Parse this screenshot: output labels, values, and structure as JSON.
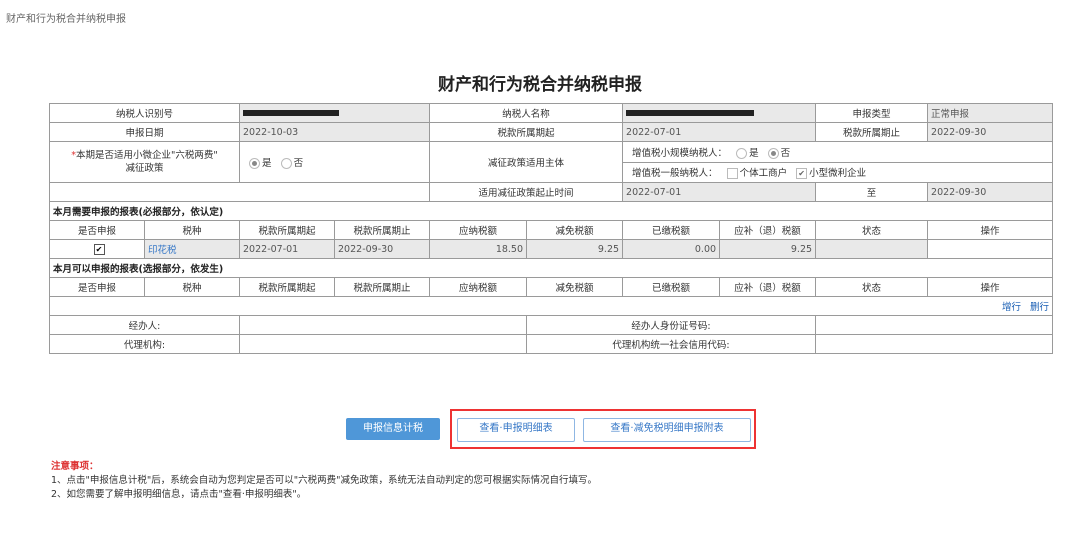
{
  "breadcrumb": "财产和行为税合并纳税申报",
  "title": "财产和行为税合并纳税申报",
  "header": {
    "taxpayer_id_label": "纳税人识别号",
    "taxpayer_name_label": "纳税人名称",
    "decl_type_label": "申报类型",
    "decl_type_value": "正常申报",
    "decl_date_label": "申报日期",
    "decl_date_value": "2022-10-03",
    "period_start_label": "税款所属期起",
    "period_start_value": "2022-07-01",
    "period_end_label": "税款所属期止",
    "period_end_value": "2022-09-30",
    "six_tax_star": "*",
    "six_tax_label": "本期是否适用小微企业\"六税两费\"",
    "six_tax_label2": "减征政策",
    "yes": "是",
    "no": "否",
    "relief_subject_label": "减征政策适用主体",
    "vat_small_label": "增值税小规模纳税人：",
    "vat_general_label": "增值税一般纳税人：",
    "individual_business": "个体工商户",
    "small_micro": "小型微利企业",
    "relief_period_label": "适用减征政策起止时间",
    "relief_start": "2022-07-01",
    "to_label": "至",
    "relief_end": "2022-09-30"
  },
  "required_section": {
    "title": "本月需要申报的报表(必报部分，依认定)",
    "columns": [
      "是否申报",
      "税种",
      "税款所属期起",
      "税款所属期止",
      "应纳税额",
      "减免税额",
      "已缴税额",
      "应补（退）税额",
      "状态",
      "操作"
    ],
    "rows": [
      {
        "declare": "✔",
        "tax": "印花税",
        "start": "2022-07-01",
        "end": "2022-09-30",
        "payable": "18.50",
        "relief": "9.25",
        "paid": "0.00",
        "due": "9.25",
        "status": "",
        "op": ""
      }
    ]
  },
  "optional_section": {
    "title": "本月可以申报的报表(选报部分，依发生)",
    "columns": [
      "是否申报",
      "税种",
      "税款所属期起",
      "税款所属期止",
      "应纳税额",
      "减免税额",
      "已缴税额",
      "应补（退）税额",
      "状态",
      "操作"
    ],
    "add_row": "增行",
    "delete_row": "删行"
  },
  "footer": {
    "agent_label": "经办人:",
    "agent_id_label": "经办人身份证号码:",
    "agency_label": "代理机构:",
    "agency_credit_label": "代理机构统一社会信用代码:"
  },
  "buttons": {
    "calc": "申报信息计税",
    "view_detail": "查看·申报明细表",
    "view_relief": "查看·减免税明细申报附表"
  },
  "notes": {
    "head": "注意事项：",
    "line1": "1、点击\"申报信息计税\"后，系统会自动为您判定是否可以\"六税两费\"减免政策，系统无法自动判定的您可根据实际情况自行填写。",
    "line2": "2、如您需要了解申报明细信息，请点击\"查看·申报明细表\"。"
  },
  "colors": {
    "primary": "#4f97d8",
    "highlight": "#e33333",
    "gray_cell": "#e9e9e9"
  }
}
